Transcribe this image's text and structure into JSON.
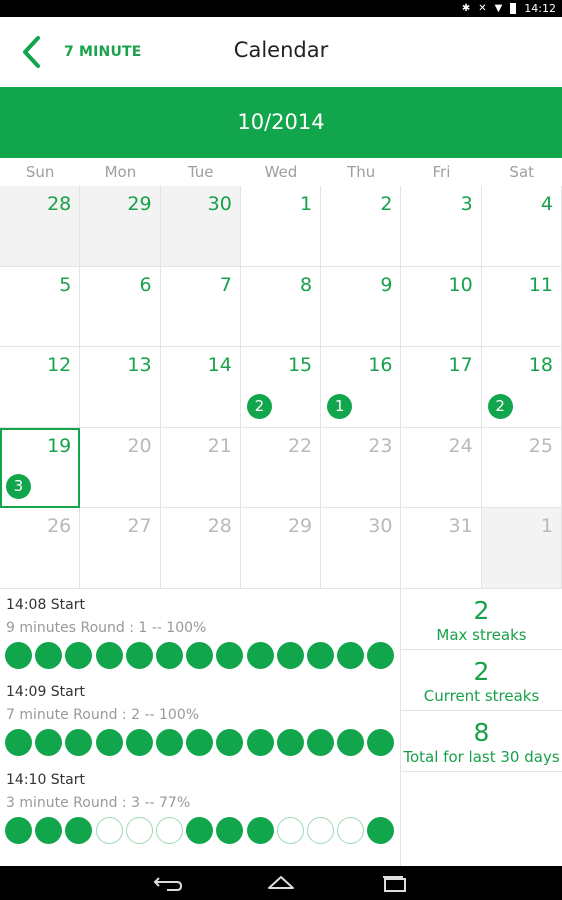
{
  "status_bar": {
    "time": "14:12",
    "icons": [
      "bluetooth-icon",
      "mute-icon",
      "wifi-icon",
      "battery-icon"
    ]
  },
  "app_bar": {
    "brand": "7 MINUTE",
    "title": "Calendar"
  },
  "month": "10/2014",
  "weekdays": [
    "Sun",
    "Mon",
    "Tue",
    "Wed",
    "Thu",
    "Fri",
    "Sat"
  ],
  "weeks": [
    [
      {
        "day": "28",
        "other": true,
        "future": false,
        "count": ""
      },
      {
        "day": "29",
        "other": true,
        "future": false,
        "count": ""
      },
      {
        "day": "30",
        "other": true,
        "future": false,
        "count": ""
      },
      {
        "day": "1",
        "other": false,
        "future": false,
        "count": ""
      },
      {
        "day": "2",
        "other": false,
        "future": false,
        "count": ""
      },
      {
        "day": "3",
        "other": false,
        "future": false,
        "count": ""
      },
      {
        "day": "4",
        "other": false,
        "future": false,
        "count": ""
      }
    ],
    [
      {
        "day": "5",
        "other": false,
        "future": false,
        "count": ""
      },
      {
        "day": "6",
        "other": false,
        "future": false,
        "count": ""
      },
      {
        "day": "7",
        "other": false,
        "future": false,
        "count": ""
      },
      {
        "day": "8",
        "other": false,
        "future": false,
        "count": ""
      },
      {
        "day": "9",
        "other": false,
        "future": false,
        "count": ""
      },
      {
        "day": "10",
        "other": false,
        "future": false,
        "count": ""
      },
      {
        "day": "11",
        "other": false,
        "future": false,
        "count": ""
      }
    ],
    [
      {
        "day": "12",
        "other": false,
        "future": false,
        "count": ""
      },
      {
        "day": "13",
        "other": false,
        "future": false,
        "count": ""
      },
      {
        "day": "14",
        "other": false,
        "future": false,
        "count": ""
      },
      {
        "day": "15",
        "other": false,
        "future": false,
        "count": "2"
      },
      {
        "day": "16",
        "other": false,
        "future": false,
        "count": "1"
      },
      {
        "day": "17",
        "other": false,
        "future": false,
        "count": ""
      },
      {
        "day": "18",
        "other": false,
        "future": false,
        "count": "2"
      }
    ],
    [
      {
        "day": "19",
        "other": false,
        "future": false,
        "today": true,
        "count": "3"
      },
      {
        "day": "20",
        "other": false,
        "future": true,
        "count": ""
      },
      {
        "day": "21",
        "other": false,
        "future": true,
        "count": ""
      },
      {
        "day": "22",
        "other": false,
        "future": true,
        "count": ""
      },
      {
        "day": "23",
        "other": false,
        "future": true,
        "count": ""
      },
      {
        "day": "24",
        "other": false,
        "future": true,
        "count": ""
      },
      {
        "day": "25",
        "other": false,
        "future": true,
        "count": ""
      }
    ],
    [
      {
        "day": "26",
        "other": false,
        "future": true,
        "count": ""
      },
      {
        "day": "27",
        "other": false,
        "future": true,
        "count": ""
      },
      {
        "day": "28",
        "other": false,
        "future": true,
        "count": ""
      },
      {
        "day": "29",
        "other": false,
        "future": true,
        "count": ""
      },
      {
        "day": "30",
        "other": false,
        "future": true,
        "count": ""
      },
      {
        "day": "31",
        "other": false,
        "future": true,
        "count": ""
      },
      {
        "day": "1",
        "other": true,
        "future": true,
        "count": ""
      }
    ]
  ],
  "sessions": [
    {
      "start": "14:08 Start",
      "round": "9 minutes Round : 1 -- 100%",
      "dots": [
        1,
        1,
        1,
        1,
        1,
        1,
        1,
        1,
        1,
        1,
        1,
        1,
        1
      ]
    },
    {
      "start": "14:09 Start",
      "round": "7 minute Round : 2 -- 100%",
      "dots": [
        1,
        1,
        1,
        1,
        1,
        1,
        1,
        1,
        1,
        1,
        1,
        1,
        1
      ]
    },
    {
      "start": "14:10 Start",
      "round": "3 minute Round : 3 -- 77%",
      "dots": [
        1,
        1,
        1,
        0,
        0,
        0,
        1,
        1,
        1,
        0,
        0,
        0,
        1
      ]
    }
  ],
  "stats": [
    {
      "value": "2",
      "label": "Max streaks"
    },
    {
      "value": "2",
      "label": "Current streaks"
    },
    {
      "value": "8",
      "label": "Total for last 30 days"
    }
  ],
  "colors": {
    "accent": "#11a54c",
    "text_green": "#18a14a",
    "muted": "#b9b9b9"
  },
  "nav_bar": {
    "icons": [
      "back-icon",
      "home-icon",
      "recents-icon"
    ]
  }
}
